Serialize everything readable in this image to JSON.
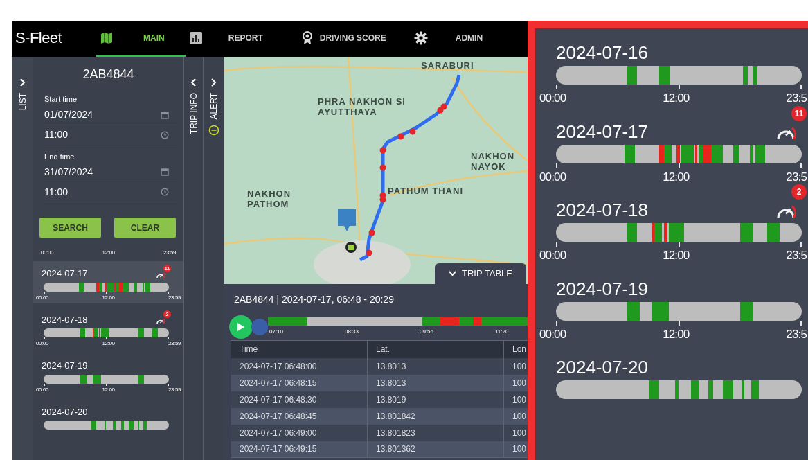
{
  "header": {
    "logo": "S-Fleet",
    "nav": [
      {
        "label": "MAIN",
        "selected": true
      },
      {
        "label": "REPORT",
        "selected": false
      },
      {
        "label": "DRIVING SCORE",
        "selected": false
      },
      {
        "label": "ADMIN",
        "selected": false
      }
    ]
  },
  "side_tabs": [
    {
      "label": "LIST",
      "kind": "list"
    },
    {
      "label": "TRIP INFO",
      "kind": "trip"
    },
    {
      "label": "ALERT",
      "kind": "alert"
    }
  ],
  "search_panel": {
    "vehicle": "2AB4844",
    "start_label": "Start time",
    "start_date": "01/07/2024",
    "start_time": "11:00",
    "end_label": "End time",
    "end_date": "31/07/2024",
    "end_time": "11:00",
    "buttons": [
      "SEARCH",
      "CLEAR"
    ],
    "axis": [
      "00:00",
      "12:00",
      "23:59"
    ],
    "days": [
      {
        "date": "2024-07-17",
        "alerts": "11",
        "selected": true,
        "axis": [
          "00:00",
          "12:00",
          "23:59"
        ]
      },
      {
        "date": "2024-07-18",
        "alerts": "2",
        "selected": false,
        "axis": [
          "00:00",
          "12:00",
          "23:59"
        ]
      },
      {
        "date": "2024-07-19",
        "selected": false,
        "axis": [
          "00:00",
          "12:00",
          "23:59"
        ]
      },
      {
        "date": "2024-07-20",
        "selected": false
      }
    ]
  },
  "map": {
    "labels": [
      "SARABURI",
      "PHRA NAKHON SI AYUTTHAYA",
      "NAKHON NAYOK",
      "NAKHON PATHOM",
      "PATHUM THANI"
    ]
  },
  "trip_table": {
    "tab": "TRIP TABLE",
    "title": "2AB4844 | 2024-07-17, 06:48 - 20:29",
    "ticks": [
      "07:10",
      "08:33",
      "09:56",
      "11:20"
    ],
    "columns": [
      "Time",
      "Lat.",
      "Lon"
    ],
    "rows": [
      [
        "2024-07-17 06:48:00",
        "13.8013",
        "100"
      ],
      [
        "2024-07-17 06:48:15",
        "13.8013",
        "100"
      ],
      [
        "2024-07-17 06:48:30",
        "13.8019",
        "100"
      ],
      [
        "2024-07-17 06:48:45",
        "13.801842",
        "100"
      ],
      [
        "2024-07-17 06:49:00",
        "13.801823",
        "100"
      ],
      [
        "2024-07-17 06:49:15",
        "13.801362",
        "100"
      ]
    ]
  },
  "zoom_panel": {
    "days": [
      {
        "date": "2024-07-16",
        "axis": [
          "00:00",
          "12:00",
          "23:5"
        ]
      },
      {
        "date": "2024-07-17",
        "alerts": "11",
        "axis": [
          "00:00",
          "12:00",
          "23:5"
        ]
      },
      {
        "date": "2024-07-18",
        "alerts": "2",
        "axis": [
          "00:00",
          "12:00",
          "23:5"
        ]
      },
      {
        "date": "2024-07-19",
        "axis": [
          "00:00",
          "12:00",
          "23:5"
        ]
      },
      {
        "date": "2024-07-20"
      }
    ]
  }
}
